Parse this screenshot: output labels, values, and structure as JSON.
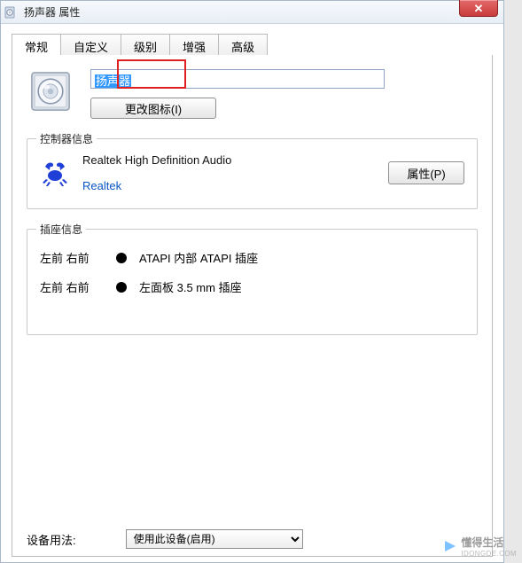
{
  "window": {
    "title": "扬声器 属性",
    "close_glyph": "✕"
  },
  "tabs": [
    {
      "label": "常规"
    },
    {
      "label": "自定义"
    },
    {
      "label": "级别"
    },
    {
      "label": "增强"
    },
    {
      "label": "高级"
    }
  ],
  "device": {
    "name": "扬声器",
    "change_icon_btn": "更改图标(I)"
  },
  "controller": {
    "legend": "控制器信息",
    "name": "Realtek High Definition Audio",
    "vendor": "Realtek",
    "properties_btn": "属性(P)"
  },
  "jacks": {
    "legend": "插座信息",
    "rows": [
      {
        "location": "左前 右前",
        "color": "#000000",
        "description": "ATAPI 内部 ATAPI 插座"
      },
      {
        "location": "左前 右前",
        "color": "#000000",
        "description": "左面板 3.5 mm 插座"
      }
    ]
  },
  "usage": {
    "label": "设备用法:",
    "selected": "使用此设备(启用)"
  },
  "watermark": {
    "line1": "懂得生活",
    "line2": "IDONGDE.COM"
  },
  "highlight": {
    "target_tab_index": 2
  }
}
